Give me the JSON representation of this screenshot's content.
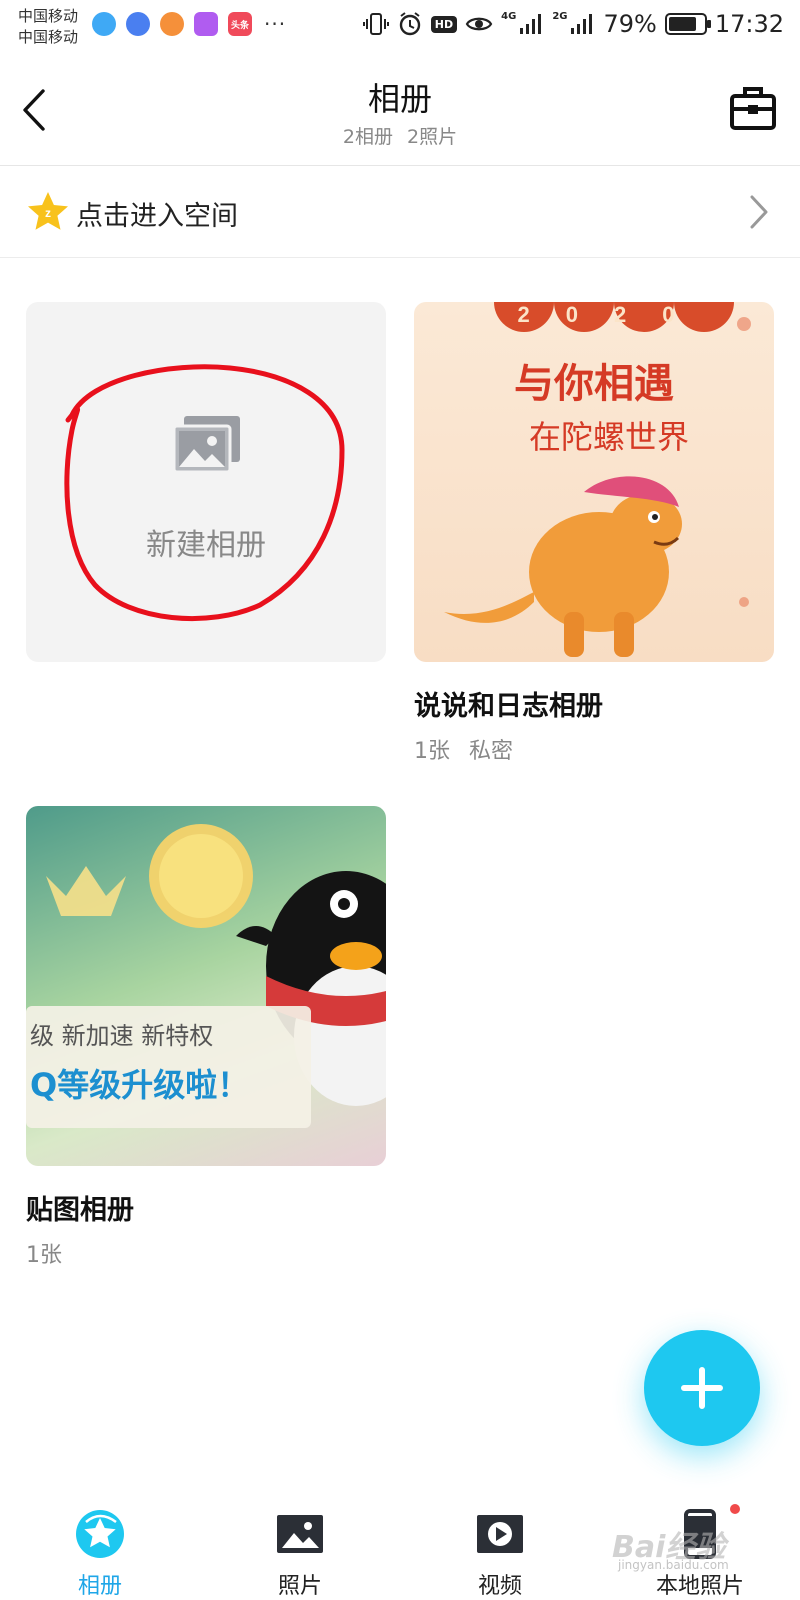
{
  "status_bar": {
    "carrier_1": "中国移动",
    "carrier_2": "中国移动",
    "more": "···",
    "network_1": "4G",
    "network_2": "2G",
    "hd": "HD",
    "battery_percent": "79%",
    "battery_level": 0.79,
    "time": "17:32",
    "app_icon_label": "头条"
  },
  "header": {
    "title": "相册",
    "album_count": "2相册",
    "photo_count": "2照片"
  },
  "space_entry": {
    "label": "点击进入空间"
  },
  "new_album": {
    "label": "新建相册"
  },
  "albums": [
    {
      "title": "说说和日志相册",
      "count": "1张",
      "privacy": "私密",
      "cover_text_1": "与你相遇",
      "cover_text_2": "在陀螺世界",
      "cover_year": "2020"
    },
    {
      "title": "贴图相册",
      "count": "1张",
      "cover_text_1": "级 新加速 新特权",
      "cover_text_2": "Q等级升级啦！"
    }
  ],
  "nav": {
    "items": [
      {
        "label": "相册",
        "icon": "album-icon",
        "active": true
      },
      {
        "label": "照片",
        "icon": "photo-icon",
        "active": false
      },
      {
        "label": "视频",
        "icon": "video-icon",
        "active": false
      },
      {
        "label": "本地照片",
        "icon": "local-photo-icon",
        "active": false
      }
    ]
  },
  "watermark": {
    "text": "Bai经验",
    "sub": "jingyan.baidu.com"
  },
  "colors": {
    "accent": "#1ec8f0",
    "nav_active": "#1ea6e8",
    "annotation_red": "#e8101c"
  }
}
